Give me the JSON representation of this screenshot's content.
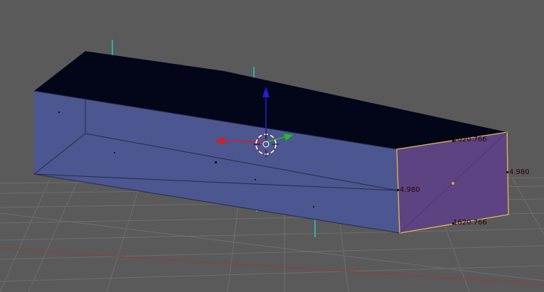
{
  "viewport": {
    "mode": "edit-mesh",
    "background_color": "#5a5a5a",
    "grid_color": "#6e6e6e",
    "x_axis_color": "#9a3a3a",
    "top_face_color": "#020618",
    "front_face_color": "#4c5690",
    "end_face_color": "#5e4382",
    "selected_edge_color": "#e0b850",
    "normal_color": "#29c6c6"
  },
  "dimensions": {
    "length_top": "1620.766",
    "length_bottom": "1620.766",
    "height_right": "4.980",
    "height_left": "4.980"
  },
  "manipulator": {
    "x_axis_color": "#d42020",
    "y_axis_color": "#20c020",
    "z_axis_color": "#2020d4",
    "cursor_icon": "3d-cursor-crosshair"
  }
}
